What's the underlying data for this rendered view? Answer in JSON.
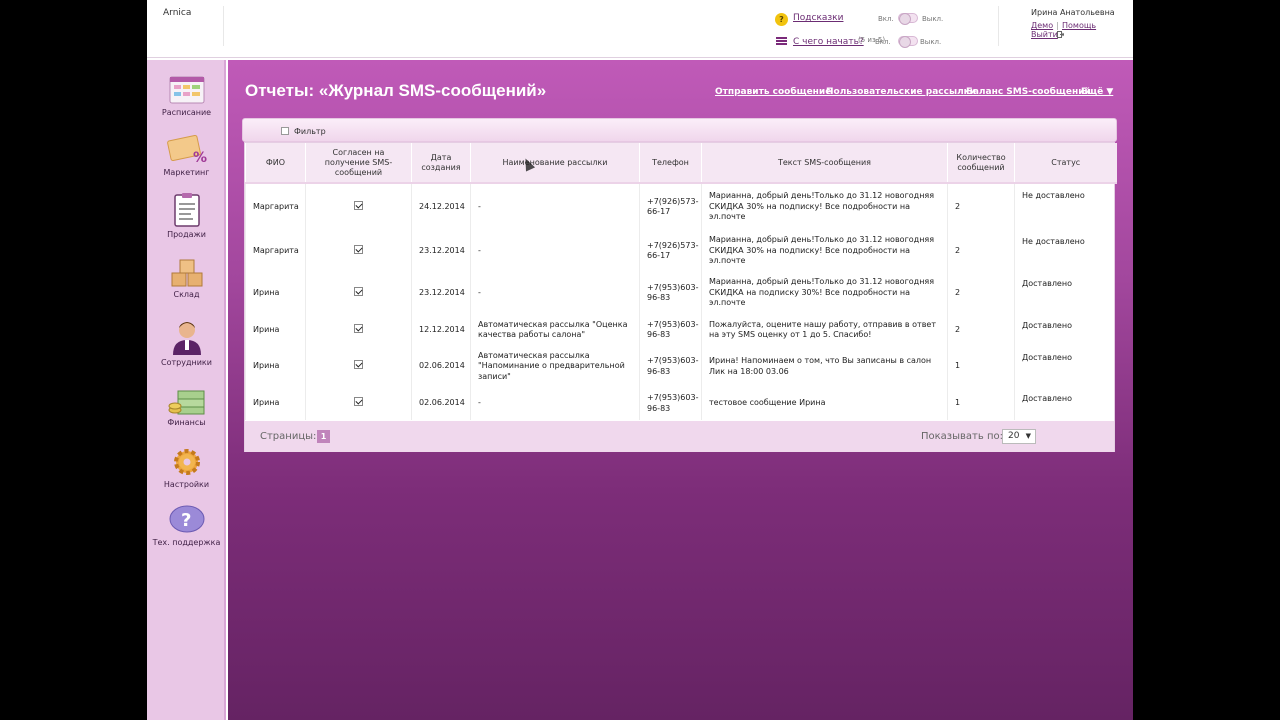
{
  "header": {
    "brand": "Arnica",
    "hints_label": "Подсказки",
    "toggle_on": "Вкл.",
    "toggle_off": "Выкл.",
    "start_label": "С чего начать?",
    "start_progress": "(5 из 5)",
    "start_toggle_on": "Вкл.",
    "start_toggle_off": "Выкл.",
    "user_name": "Ирина Анатольевна",
    "demo": "Демо",
    "separator": "|",
    "help": "Помощь",
    "logout": "Выйти"
  },
  "sidebar": {
    "items": [
      {
        "label": "Расписание",
        "icon": "schedule-icon"
      },
      {
        "label": "Маркетинг",
        "icon": "marketing-icon"
      },
      {
        "label": "Продажи",
        "icon": "sales-icon"
      },
      {
        "label": "Склад",
        "icon": "warehouse-icon"
      },
      {
        "label": "Сотрудники",
        "icon": "employees-icon"
      },
      {
        "label": "Финансы",
        "icon": "finance-icon"
      },
      {
        "label": "Настройки",
        "icon": "settings-icon"
      },
      {
        "label": "Тех. поддержка",
        "icon": "support-icon"
      }
    ]
  },
  "main": {
    "title": "Отчеты: «Журнал SMS-сообщений»",
    "links": {
      "send": "Отправить сообщение",
      "custom": "Пользовательские рассылки",
      "balance": "Баланс SMS-сообщений",
      "more": "Ещё ▼"
    },
    "filter_label": "Фильтр"
  },
  "table": {
    "headers": {
      "name": "ФИО",
      "consent": "Согласен на получение SMS-сообщений",
      "date": "Дата создания",
      "mailing": "Наименование рассылки",
      "phone": "Телефон",
      "text": "Текст SMS-сообщения",
      "count": "Количество сообщений",
      "status": "Статус"
    },
    "rows": [
      {
        "name": "Маргарита",
        "date": "24.12.2014",
        "mailing": "-",
        "phone": "+7(926)573-66-17",
        "text": "Марианна, добрый день!Только до 31.12 новогодняя СКИДКА 30% на подписку! Все подробности на эл.почте",
        "count": "2",
        "status": "Не доставлено"
      },
      {
        "name": "Маргарита",
        "date": "23.12.2014",
        "mailing": "-",
        "phone": "+7(926)573-66-17",
        "text": "Марианна, добрый день!Только до 31.12 новогодняя СКИДКА 30% на подписку! Все подробности на эл.почте",
        "count": "2",
        "status": "Не доставлено"
      },
      {
        "name": "Ирина",
        "date": "23.12.2014",
        "mailing": "-",
        "phone": "+7(953)603-96-83",
        "text": "Марианна, добрый день!Только до 31.12 новогодняя СКИДКА на подписку 30%! Все подробности на эл.почте",
        "count": "2",
        "status": "Доставлено"
      },
      {
        "name": "Ирина",
        "date": "12.12.2014",
        "mailing": "Автоматическая рассылка \"Оценка качества работы салона\"",
        "phone": "+7(953)603-96-83",
        "text": "Пожалуйста, оцените нашу работу, отправив в ответ на эту SMS оценку от 1 до 5. Спасибо!",
        "count": "2",
        "status": "Доставлено"
      },
      {
        "name": "Ирина",
        "date": "02.06.2014",
        "mailing": "Автоматическая рассылка \"Напоминание о предварительной записи\"",
        "phone": "+7(953)603-96-83",
        "text": "Ирина! Напоминаем о том, что Вы записаны в салон Лик на 18:00 03.06",
        "count": "1",
        "status": "Доставлено"
      },
      {
        "name": "Ирина",
        "date": "02.06.2014",
        "mailing": "-",
        "phone": "+7(953)603-96-83",
        "text": "тестовое сообщение Ирина",
        "count": "1",
        "status": "Доставлено"
      }
    ]
  },
  "pager": {
    "pages_label": "Страницы:",
    "current_page": "1",
    "show_label": "Показывать по:",
    "per_page": "20",
    "caret": "▼"
  }
}
